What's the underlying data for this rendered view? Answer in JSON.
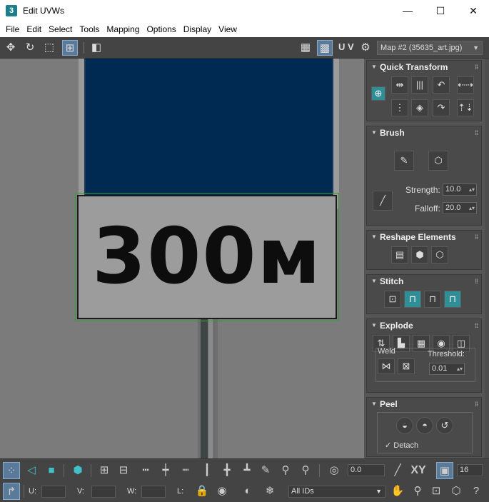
{
  "window": {
    "app_icon_text": "3",
    "title": "Edit UVWs",
    "minimize_glyph": "—",
    "maximize_glyph": "☐",
    "close_glyph": "✕"
  },
  "menu": [
    "File",
    "Edit",
    "Select",
    "Tools",
    "Mapping",
    "Options",
    "Display",
    "View"
  ],
  "top_toolbar": {
    "uv_label": "U V",
    "map_selector": "Map #2 (35635_art.jpg)",
    "icons": [
      "move-icon",
      "rotate-icon",
      "scale-icon",
      "freeform-icon",
      "mirror-icon",
      "checker-icon",
      "checker-active-icon",
      "map-settings-icon"
    ]
  },
  "viewport": {
    "sign_text": "300м",
    "colors": {
      "background": "#7b7b7b",
      "blue_sign": "#002a52",
      "selection": "#3c9a3c"
    }
  },
  "panel": {
    "quick_transform": {
      "title": "Quick Transform"
    },
    "brush": {
      "title": "Brush",
      "strength_label": "Strength:",
      "strength_value": "10.0",
      "falloff_label": "Falloff:",
      "falloff_value": "20.0"
    },
    "reshape": {
      "title": "Reshape Elements"
    },
    "stitch": {
      "title": "Stitch"
    },
    "explode": {
      "title": "Explode",
      "weld_label": "Weld",
      "threshold_label": "Threshold:",
      "threshold_value": "0.01"
    },
    "peel": {
      "title": "Peel",
      "detach_label": "Detach"
    }
  },
  "bottom_toolbar": {
    "angle_value": "0.0",
    "xy_label": "XY",
    "count_value": "16",
    "u_label": "U:",
    "v_label": "V:",
    "w_label": "W:",
    "l_label": "L:",
    "ids_selector": "All IDs"
  },
  "accent_color": "#2f8e96"
}
